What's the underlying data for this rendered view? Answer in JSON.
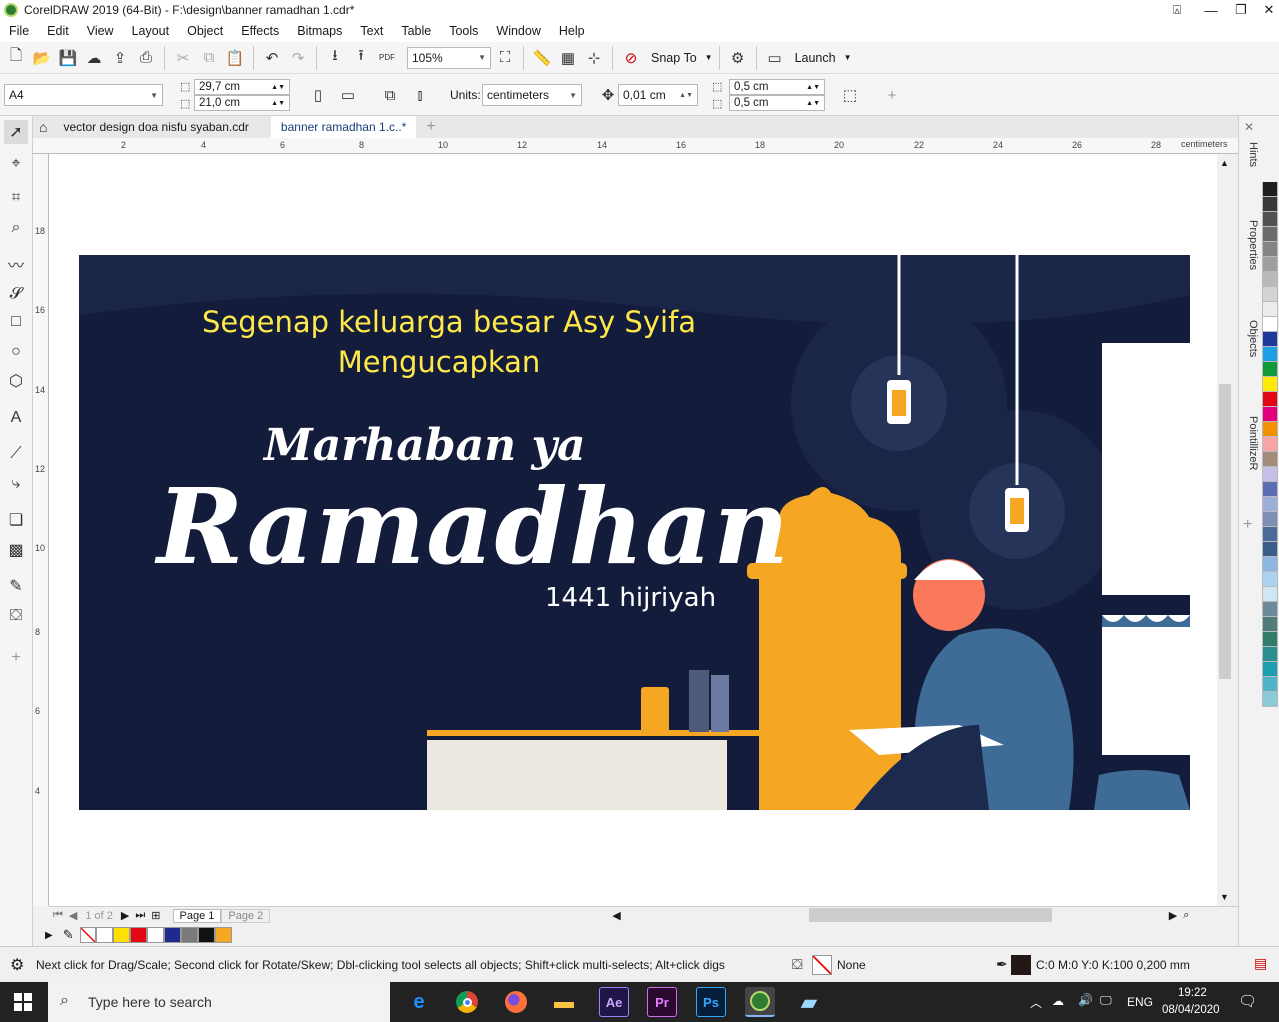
{
  "window": {
    "title": "CorelDRAW 2019 (64-Bit) - F:\\design\\banner ramadhan 1.cdr*"
  },
  "menu": [
    "File",
    "Edit",
    "View",
    "Layout",
    "Object",
    "Effects",
    "Bitmaps",
    "Text",
    "Table",
    "Tools",
    "Window",
    "Help"
  ],
  "toolbar": {
    "zoom": "105%",
    "snap_to": "Snap To",
    "launch": "Launch",
    "pdf": "PDF"
  },
  "property_bar": {
    "page_size": "A4",
    "width": "29,7 cm",
    "height": "21,0 cm",
    "units_label": "Units:",
    "units": "centimeters",
    "nudge": "0,01 cm",
    "dup_x": "0,5 cm",
    "dup_y": "0,5 cm"
  },
  "doc_tabs": [
    "vector design doa nisfu syaban.cdr",
    "banner ramadhan 1.c..*"
  ],
  "ruler": {
    "unit": "centimeters",
    "h_ticks": [
      "2",
      "4",
      "6",
      "8",
      "10",
      "12",
      "14",
      "16",
      "18",
      "20",
      "22",
      "24",
      "26",
      "28"
    ],
    "v_ticks": [
      "18",
      "16",
      "14",
      "12",
      "10",
      "8",
      "6",
      "4"
    ]
  },
  "banner": {
    "greeting_line1": "Segenap keluarga besar Asy Syifa",
    "greeting_line2": "Mengucapkan",
    "marhaban": "Marhaban ya",
    "ramadhan": "Ramadhan",
    "hijri": "1441 hijriyah",
    "colors": {
      "background": "#131d3b",
      "greeting": "#ffe84a",
      "accent": "#f5a623",
      "robe": "#3f6c96"
    }
  },
  "dockers": [
    "Hints",
    "Properties",
    "Objects",
    "PointillizeR"
  ],
  "page_nav": {
    "counter": "1 of 2",
    "pages": [
      "Page 1",
      "Page 2"
    ]
  },
  "doc_palette_colors": [
    "#ffffff",
    "#ffe000",
    "#e30613",
    "#ffffff",
    "#1e2a8c",
    "#7a7a7a",
    "#111111",
    "#f5a623"
  ],
  "color_palette": [
    "#1f1f1f",
    "#383838",
    "#515151",
    "#6b6b6b",
    "#858585",
    "#9f9f9f",
    "#b9b9b9",
    "#d3d3d3",
    "#ececec",
    "#ffffff",
    "#1e3a9a",
    "#1ea0e6",
    "#0f9b3c",
    "#ffec00",
    "#e30613",
    "#e4007c",
    "#f29200",
    "#f7a5a5",
    "#a58c7a",
    "#c8bfe6",
    "#5b6eb4",
    "#9bb0d8",
    "#7d8fb3",
    "#4a6a9a",
    "#3a5d8c",
    "#8db6e0",
    "#a9d3f0",
    "#cfe7f5",
    "#6b8a9a",
    "#4e7d7a",
    "#2f7d6a",
    "#2c8f8f",
    "#1b9fb0",
    "#4fb3c9",
    "#8dcad8"
  ],
  "status": {
    "hint": "Next click for Drag/Scale; Second click for Rotate/Skew; Dbl-clicking tool selects all objects; Shift+click multi-selects; Alt+click digs",
    "fill": "None",
    "outline": "C:0 M:0 Y:0 K:100  0,200 mm"
  },
  "taskbar": {
    "search_placeholder": "Type here to search",
    "language": "ENG",
    "time": "19:22",
    "date": "08/04/2020",
    "apps": [
      "Edge",
      "Chrome",
      "Firefox",
      "Explorer",
      "Ae",
      "Pr",
      "Ps",
      "CorelDRAW",
      "Notes"
    ]
  }
}
